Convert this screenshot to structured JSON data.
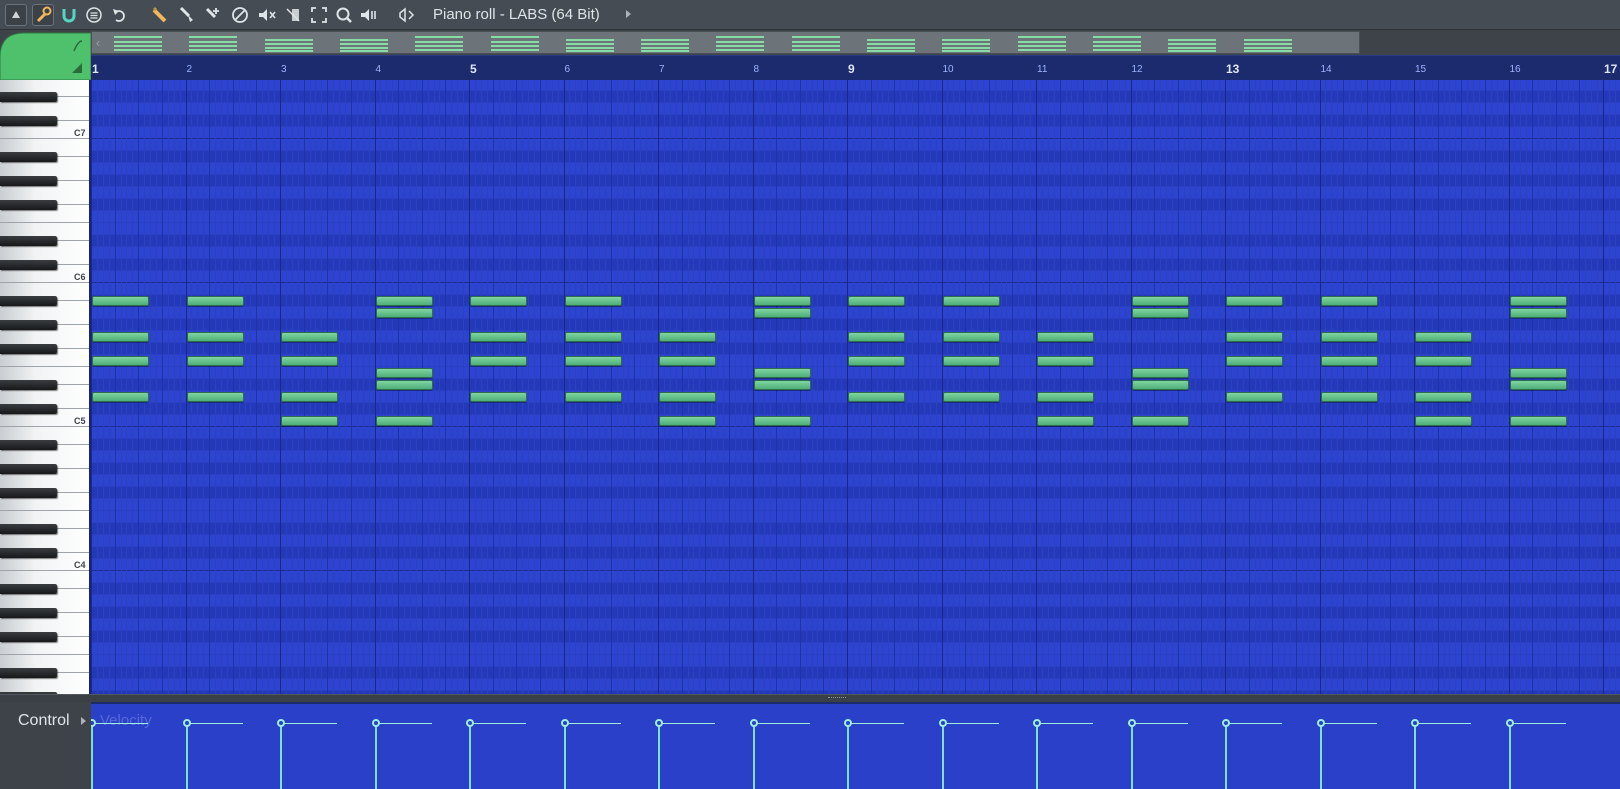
{
  "window": {
    "title": "Piano roll - LABS (64 Bit)"
  },
  "toolbar": {
    "tools": [
      {
        "name": "menu-arrow-icon"
      },
      {
        "name": "wrench-icon"
      },
      {
        "name": "magnet-icon"
      },
      {
        "name": "playlist-menu-icon"
      },
      {
        "name": "undo-icon"
      },
      {
        "name": "pencil-icon"
      },
      {
        "name": "paint-brush-icon"
      },
      {
        "name": "delete-tool-icon"
      },
      {
        "name": "no-entry-icon"
      },
      {
        "name": "mute-icon"
      },
      {
        "name": "slice-icon"
      },
      {
        "name": "select-icon"
      },
      {
        "name": "zoom-icon"
      },
      {
        "name": "playback-icon"
      },
      {
        "name": "speaker-icon"
      }
    ]
  },
  "ruler": {
    "bars": [
      "1",
      "2",
      "3",
      "4",
      "5",
      "6",
      "7",
      "8",
      "9",
      "10",
      "11",
      "12",
      "13",
      "14",
      "15",
      "16",
      "17"
    ],
    "major_bars": [
      "1",
      "5",
      "9",
      "13",
      "17"
    ]
  },
  "keyboard": {
    "labels": [
      "C7",
      "C6",
      "C5",
      "C4"
    ]
  },
  "notes": {
    "bar_pitches": [
      [
        "F5",
        "D5",
        "G5",
        "A#5"
      ],
      [
        "F5",
        "D5",
        "G5",
        "A#5"
      ],
      [
        "C5",
        "F5",
        "D5",
        "G5"
      ],
      [
        "C5",
        "E5",
        "D#5",
        "A5",
        "A#5"
      ],
      [
        "F5",
        "D5",
        "G5",
        "A#5"
      ],
      [
        "F5",
        "D5",
        "G5",
        "A#5"
      ],
      [
        "C5",
        "F5",
        "D5",
        "G5"
      ],
      [
        "C5",
        "E5",
        "D#5",
        "A5",
        "A#5"
      ],
      [
        "F5",
        "D5",
        "G5",
        "A#5"
      ],
      [
        "F5",
        "D5",
        "G5",
        "A#5"
      ],
      [
        "C5",
        "F5",
        "D5",
        "G5"
      ],
      [
        "C5",
        "E5",
        "D#5",
        "A5",
        "A#5"
      ],
      [
        "F5",
        "D5",
        "G5",
        "A#5"
      ],
      [
        "F5",
        "D5",
        "G5",
        "A#5"
      ],
      [
        "C5",
        "F5",
        "D5",
        "G5"
      ],
      [
        "C5",
        "E5",
        "D#5",
        "A5",
        "A#5"
      ]
    ],
    "note_length_steps": 2.5
  },
  "control": {
    "label": "Control",
    "parameter": "Velocity",
    "velocity_fraction": 0.78
  },
  "colors": {
    "grid_background": "#2a40c8",
    "note_fill": "#6bc892",
    "velocity": "#9eeedb",
    "accent_green": "#4fc06c"
  }
}
